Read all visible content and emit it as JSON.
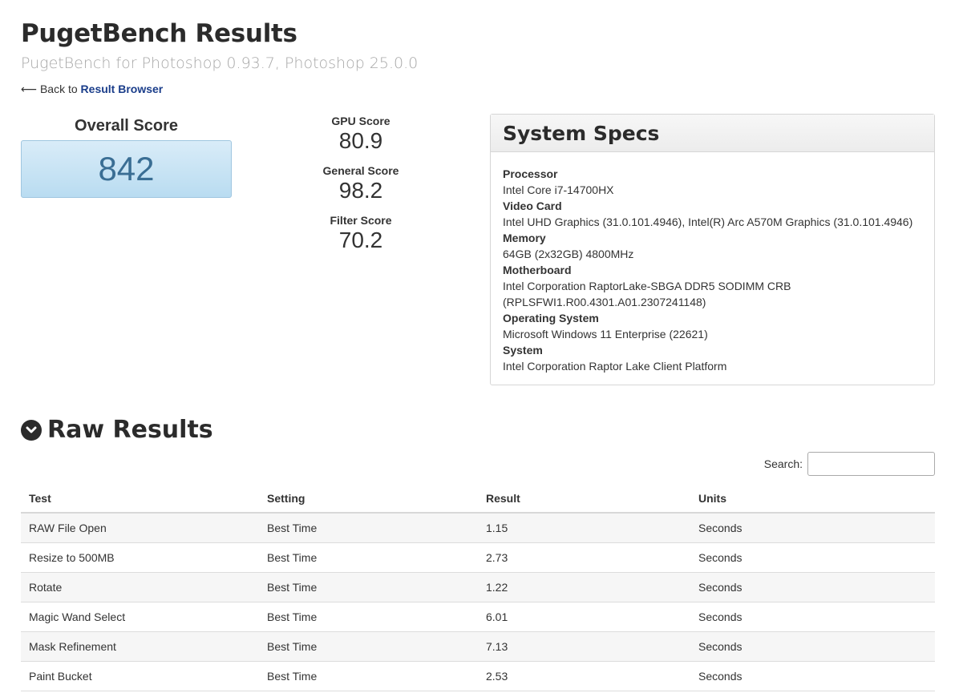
{
  "header": {
    "title": "PugetBench Results",
    "subtitle": "PugetBench for Photoshop 0.93.7, Photoshop 25.0.0",
    "back_prefix": "⟵ Back to ",
    "back_link": "Result Browser"
  },
  "scores": {
    "overall_label": "Overall Score",
    "overall_value": "842",
    "items": [
      {
        "label": "GPU Score",
        "value": "80.9"
      },
      {
        "label": "General Score",
        "value": "98.2"
      },
      {
        "label": "Filter Score",
        "value": "70.2"
      }
    ]
  },
  "specs": {
    "title": "System Specs",
    "rows": [
      {
        "label": "Processor",
        "value": "Intel Core i7-14700HX"
      },
      {
        "label": "Video Card",
        "value": "Intel UHD Graphics (31.0.101.4946), Intel(R) Arc A570M Graphics (31.0.101.4946)"
      },
      {
        "label": "Memory",
        "value": "64GB (2x32GB) 4800MHz"
      },
      {
        "label": "Motherboard",
        "value": "Intel Corporation RaptorLake-SBGA DDR5 SODIMM CRB",
        "value2": "(RPLSFWI1.R00.4301.A01.2307241148)"
      },
      {
        "label": "Operating System",
        "value": "Microsoft Windows 11 Enterprise (22621)"
      },
      {
        "label": "System",
        "value": "Intel Corporation Raptor Lake Client Platform"
      }
    ]
  },
  "raw": {
    "title": "Raw Results",
    "toggle_icon": "chevron-down-icon",
    "search_label": "Search:",
    "search_value": "",
    "columns": [
      "Test",
      "Setting",
      "Result",
      "Units"
    ],
    "rows": [
      [
        "RAW File Open",
        "Best Time",
        "1.15",
        "Seconds"
      ],
      [
        "Resize to 500MB",
        "Best Time",
        "2.73",
        "Seconds"
      ],
      [
        "Rotate",
        "Best Time",
        "1.22",
        "Seconds"
      ],
      [
        "Magic Wand Select",
        "Best Time",
        "6.01",
        "Seconds"
      ],
      [
        "Mask Refinement",
        "Best Time",
        "7.13",
        "Seconds"
      ],
      [
        "Paint Bucket",
        "Best Time",
        "2.53",
        "Seconds"
      ]
    ]
  }
}
